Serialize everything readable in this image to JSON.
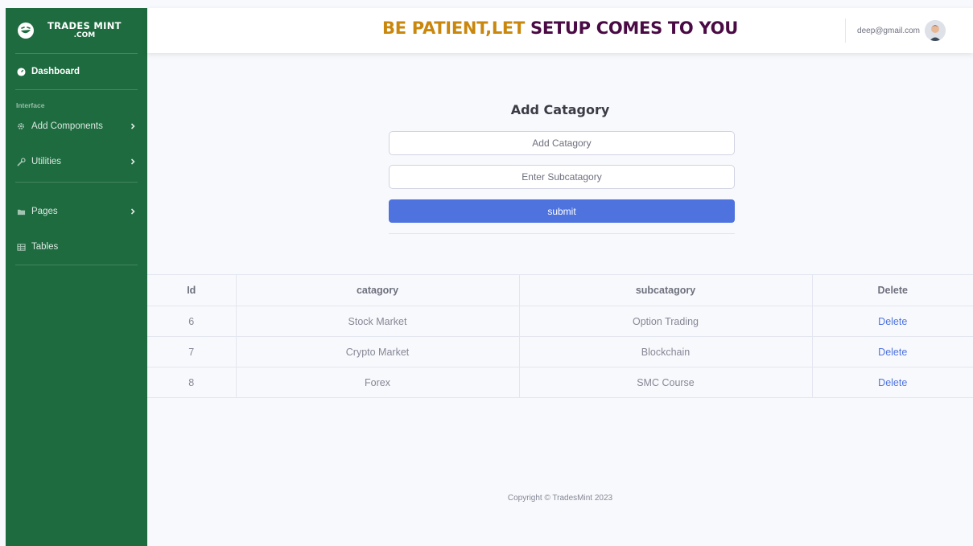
{
  "brand": {
    "line1": "TRADES MINT",
    "line2": ".COM"
  },
  "sidebar": {
    "dashboard": "Dashboard",
    "section_heading": "Interface",
    "items": [
      {
        "label": "Add Components",
        "icon": "gear-icon"
      },
      {
        "label": "Utilities",
        "icon": "wrench-icon"
      },
      {
        "label": "Pages",
        "icon": "folder-icon"
      },
      {
        "label": "Tables",
        "icon": "table-icon"
      }
    ]
  },
  "header": {
    "slogan_part1": "BE PATIENT,LET ",
    "slogan_part2": "SETUP COMES TO YOU",
    "user_email": "deep@gmail.com"
  },
  "form": {
    "title": "Add Catagory",
    "category_placeholder": "Add Catagory",
    "subcategory_placeholder": "Enter Subcatagory",
    "submit_label": "submit"
  },
  "table": {
    "headers": [
      "Id",
      "catagory",
      "subcatagory",
      "Delete"
    ],
    "rows": [
      {
        "id": "6",
        "category": "Stock Market",
        "subcategory": "Option Trading",
        "action": "Delete"
      },
      {
        "id": "7",
        "category": "Crypto Market",
        "subcategory": "Blockchain",
        "action": "Delete"
      },
      {
        "id": "8",
        "category": "Forex",
        "subcategory": "SMC Course",
        "action": "Delete"
      }
    ]
  },
  "footer": {
    "copyright": "Copyright © TradesMint 2023"
  },
  "colors": {
    "sidebar": "#1d6b3f",
    "primary": "#4e73df",
    "slogan_gold": "#c9870d",
    "slogan_purple": "#4a0a44"
  }
}
